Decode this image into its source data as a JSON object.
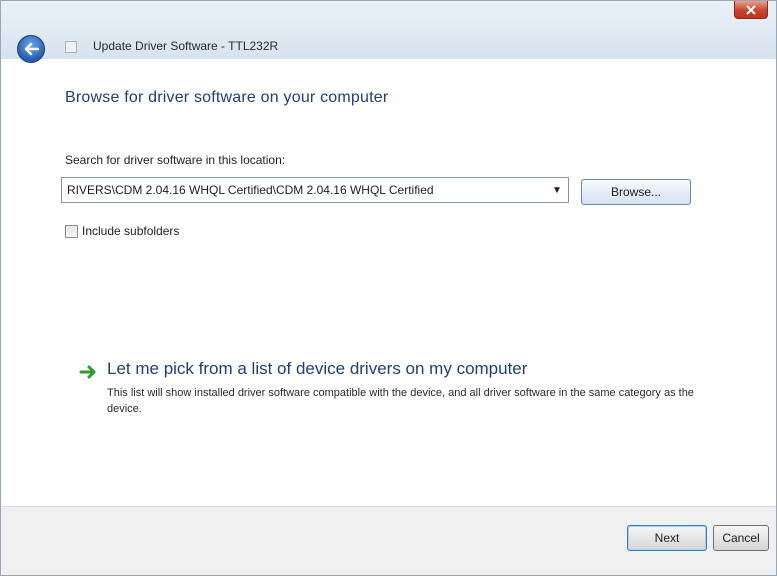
{
  "window": {
    "title": "Update Driver Software - TTL232R"
  },
  "main": {
    "heading": "Browse for driver software on your computer",
    "search_label": "Search for driver software in this location:",
    "path_value": "RIVERS\\CDM 2.04.16 WHQL Certified\\CDM 2.04.16 WHQL Certified",
    "browse_label": "Browse...",
    "include_subfolders_label": "Include subfolders",
    "include_subfolders_checked": false,
    "pick_title": "Let me pick from a list of device drivers on my computer",
    "pick_description": "This list will show installed driver software compatible with the device, and all driver software in the same category as the device."
  },
  "footer": {
    "next_label": "Next",
    "cancel_label": "Cancel"
  },
  "colors": {
    "heading": "#1f3f77",
    "close_button": "#c8452f",
    "arrow_green": "#2f9a2f"
  },
  "icons": {
    "back": "back-arrow-icon",
    "close": "close-icon",
    "window": "device-icon",
    "pick": "green-arrow-icon",
    "dropdown": "chevron-down-icon"
  }
}
